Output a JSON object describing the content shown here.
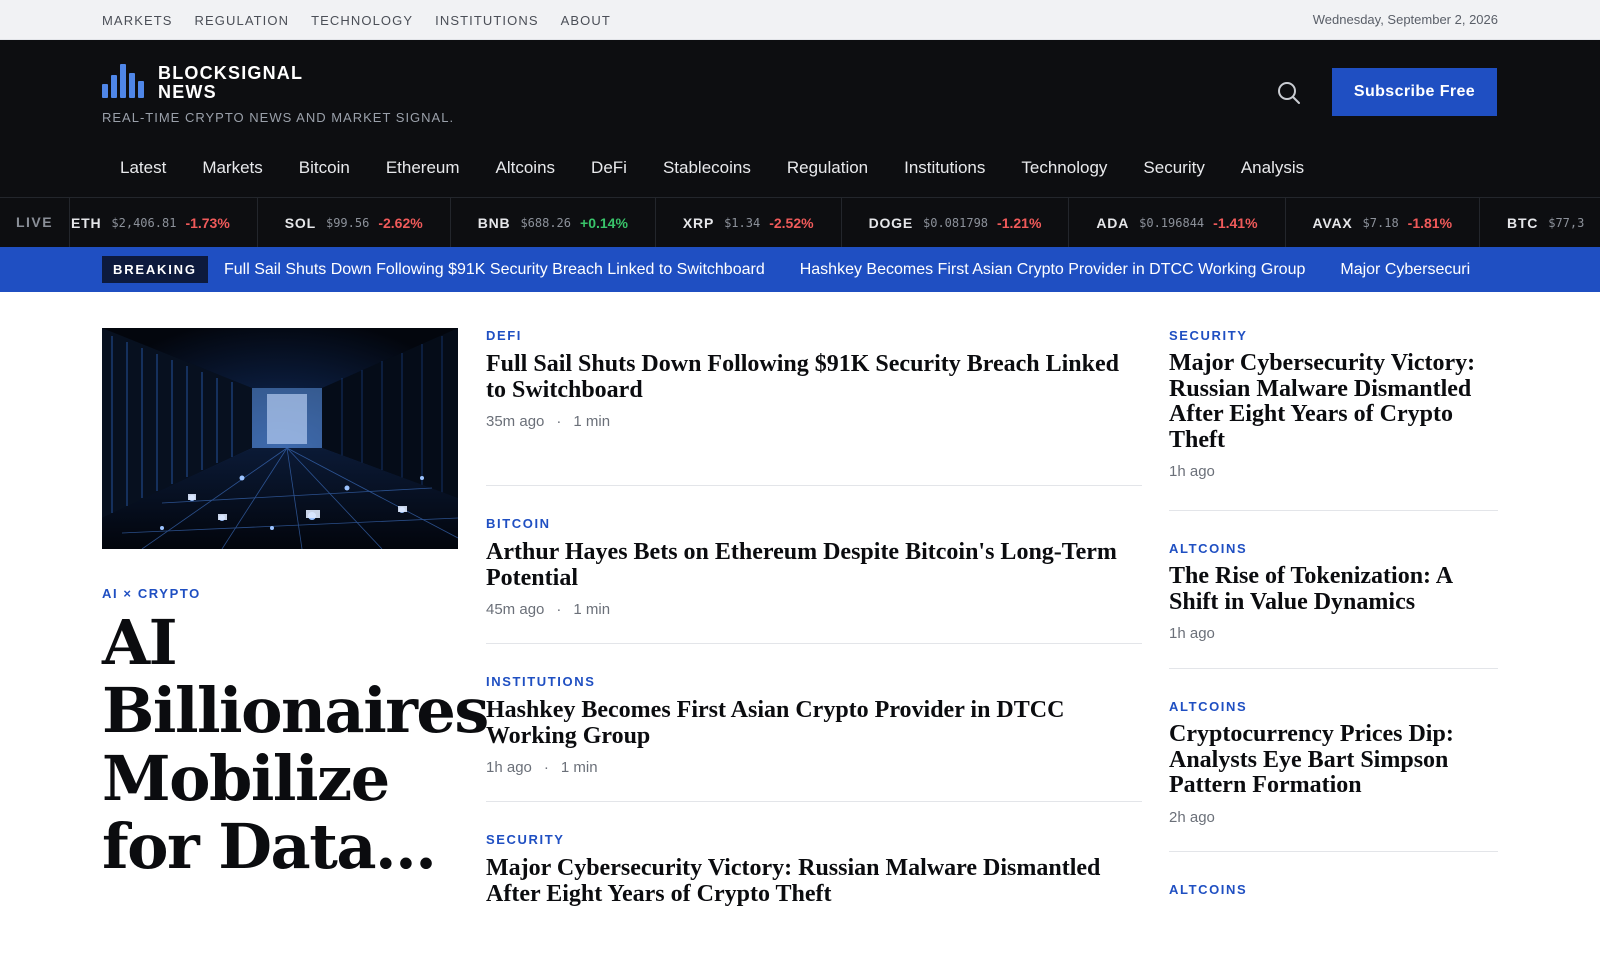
{
  "utility": {
    "links": [
      "MARKETS",
      "REGULATION",
      "TECHNOLOGY",
      "INSTITUTIONS",
      "ABOUT"
    ],
    "date": "Wednesday, September 2, 2026"
  },
  "brand": {
    "name_line1": "BLOCKSIGNAL",
    "name_line2": "NEWS",
    "tagline": "REAL-TIME CRYPTO NEWS AND MARKET SIGNAL.",
    "accent_color": "#1f4fc2"
  },
  "header": {
    "search_icon": "search-icon",
    "subscribe_label": "Subscribe Free"
  },
  "nav": [
    "Latest",
    "Markets",
    "Bitcoin",
    "Ethereum",
    "Altcoins",
    "DeFi",
    "Stablecoins",
    "Regulation",
    "Institutions",
    "Technology",
    "Security",
    "Analysis"
  ],
  "ticker": {
    "live_label": "LIVE",
    "items": [
      {
        "symbol": "ETH",
        "price": "$2,406.81",
        "change": "-1.73%",
        "direction": "down"
      },
      {
        "symbol": "SOL",
        "price": "$99.56",
        "change": "-2.62%",
        "direction": "down"
      },
      {
        "symbol": "BNB",
        "price": "$688.26",
        "change": "+0.14%",
        "direction": "up"
      },
      {
        "symbol": "XRP",
        "price": "$1.34",
        "change": "-2.52%",
        "direction": "down"
      },
      {
        "symbol": "DOGE",
        "price": "$0.081798",
        "change": "-1.21%",
        "direction": "down"
      },
      {
        "symbol": "ADA",
        "price": "$0.196844",
        "change": "-1.41%",
        "direction": "down"
      },
      {
        "symbol": "AVAX",
        "price": "$7.18",
        "change": "-1.81%",
        "direction": "down"
      },
      {
        "symbol": "BTC",
        "price": "$77,3",
        "change": "",
        "direction": "down"
      }
    ]
  },
  "breaking": {
    "label": "BREAKING",
    "headlines": [
      "Full Sail Shuts Down Following $91K Security Breach Linked to Switchboard",
      "Hashkey Becomes First Asian Crypto Provider in DTCC Working Group",
      "Major Cybersecuri"
    ]
  },
  "lead": {
    "category": "AI × CRYPTO",
    "title": "AI Billionaires Mobilize for Data..."
  },
  "middle": [
    {
      "category": "DEFI",
      "title": "Full Sail Shuts Down Following $91K Security Breach Linked to Switchboard",
      "time": "35m ago",
      "read": "1 min"
    },
    {
      "category": "BITCOIN",
      "title": "Arthur Hayes Bets on Ethereum Despite Bitcoin's Long-Term Potential",
      "time": "45m ago",
      "read": "1 min"
    },
    {
      "category": "INSTITUTIONS",
      "title": "Hashkey Becomes First Asian Crypto Provider in DTCC Working Group",
      "time": "1h ago",
      "read": "1 min"
    },
    {
      "category": "SECURITY",
      "title": "Major Cybersecurity Victory: Russian Malware Dismantled After Eight Years of Crypto Theft",
      "time": "",
      "read": ""
    }
  ],
  "right": [
    {
      "category": "SECURITY",
      "title": "Major Cybersecurity Victory: Russian Malware Dismantled After Eight Years of Crypto Theft",
      "time": "1h ago"
    },
    {
      "category": "ALTCOINS",
      "title": "The Rise of Tokenization: A Shift in Value Dynamics",
      "time": "1h ago"
    },
    {
      "category": "ALTCOINS",
      "title": "Cryptocurrency Prices Dip: Analysts Eye Bart Simpson Pattern Formation",
      "time": "2h ago"
    },
    {
      "category": "ALTCOINS",
      "title": "",
      "time": ""
    }
  ]
}
